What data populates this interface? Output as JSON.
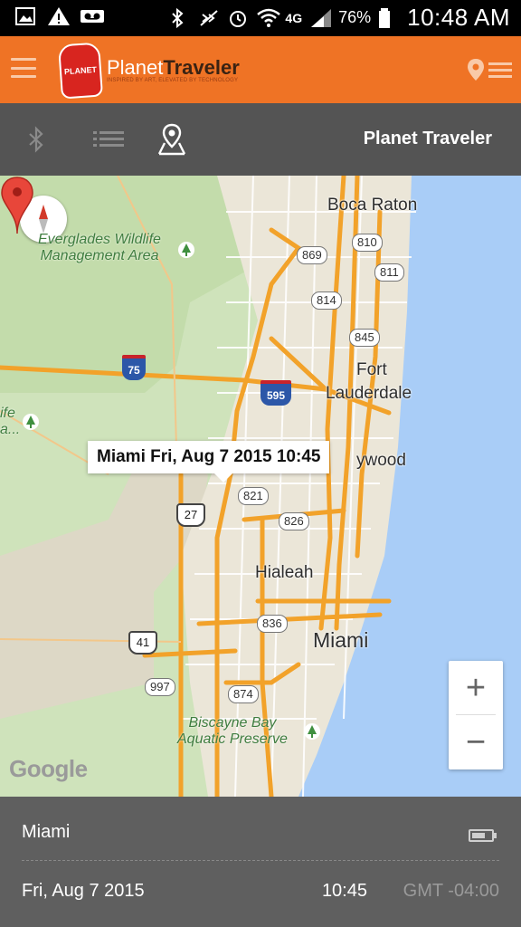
{
  "status_bar": {
    "battery_percent": "76%",
    "network": "4G",
    "time": "10:48 AM"
  },
  "app_bar": {
    "logo_badge": "PLANET",
    "logo_name_part1": "Planet",
    "logo_name_part2": "Traveler",
    "logo_tagline": "INSPIRED BY ART, ELEVATED BY TECHNOLOGY"
  },
  "sub_bar": {
    "title": "Planet Traveler"
  },
  "map": {
    "labels": {
      "boca_raton": "Boca Raton",
      "fort": "Fort",
      "lauderdale": "Lauderdale",
      "hollywood": "ywood",
      "hialeah": "Hialeah",
      "miami": "Miami",
      "everglades": "Everglades Wildlife\nManagement Area",
      "everglades_left": "ife\na...",
      "biscayne": "Biscayne Bay\nAquatic Preserve"
    },
    "shields": {
      "r810": "810",
      "r869": "869",
      "r811": "811",
      "r814": "814",
      "r845": "845",
      "i75": "75",
      "i595": "595",
      "r821": "821",
      "us27": "27",
      "r826": "826",
      "r836": "836",
      "us41": "41",
      "r997": "997",
      "r874": "874"
    },
    "info_window": "Miami Fri, Aug 7 2015 10:45",
    "zoom_in": "+",
    "zoom_out": "−",
    "attribution": "Google"
  },
  "details": {
    "city": "Miami",
    "date": "Fri, Aug 7 2015",
    "time": "10:45",
    "timezone": "GMT -04:00"
  },
  "colors": {
    "accent": "#ef7325",
    "subbar": "#545454",
    "bottom": "#5f5f5f",
    "water": "#a9cdf7",
    "highway": "#f2a22a"
  }
}
